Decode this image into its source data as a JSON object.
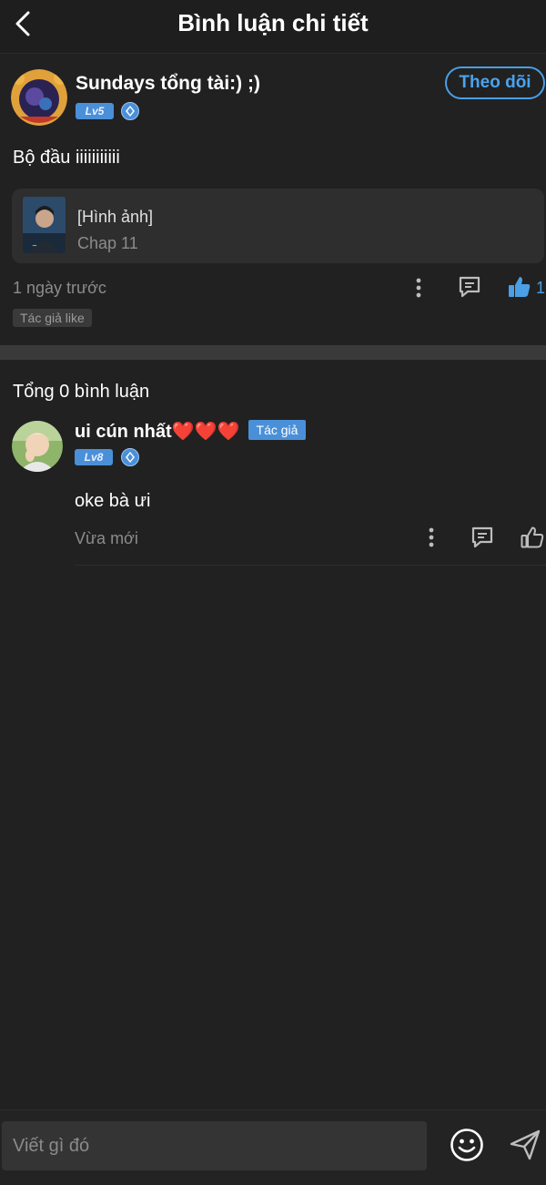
{
  "header": {
    "title": "Bình luận chi tiết"
  },
  "post": {
    "username": "Sundays tổng tài:) ;)",
    "level": "Lv5",
    "follow_label": "Theo dõi",
    "text": "Bộ đầu iiiiiiiiiii",
    "reference": {
      "title": "[Hình ảnh]",
      "chapter": "Chap 11"
    },
    "time": "1 ngày trước",
    "like_count": "1",
    "author_like_tag": "Tác giả like"
  },
  "replies": {
    "total_label": "Tổng 0 bình luận",
    "items": [
      {
        "username": "ui cún nhất❤️❤️❤️",
        "author_badge": "Tác giả",
        "level": "Lv8",
        "text": "oke bà ưi",
        "time": "Vừa mới"
      }
    ]
  },
  "composer": {
    "placeholder": "Viết gì đó"
  },
  "colors": {
    "background": "#212121",
    "accent": "#4a90d9",
    "follow": "#4aa3ef",
    "muted": "#8c8c8c"
  },
  "icons": [
    "back-arrow-icon",
    "diamond-icon",
    "more-vertical-icon",
    "comment-icon",
    "thumbs-up-icon",
    "emoji-icon",
    "send-icon"
  ]
}
